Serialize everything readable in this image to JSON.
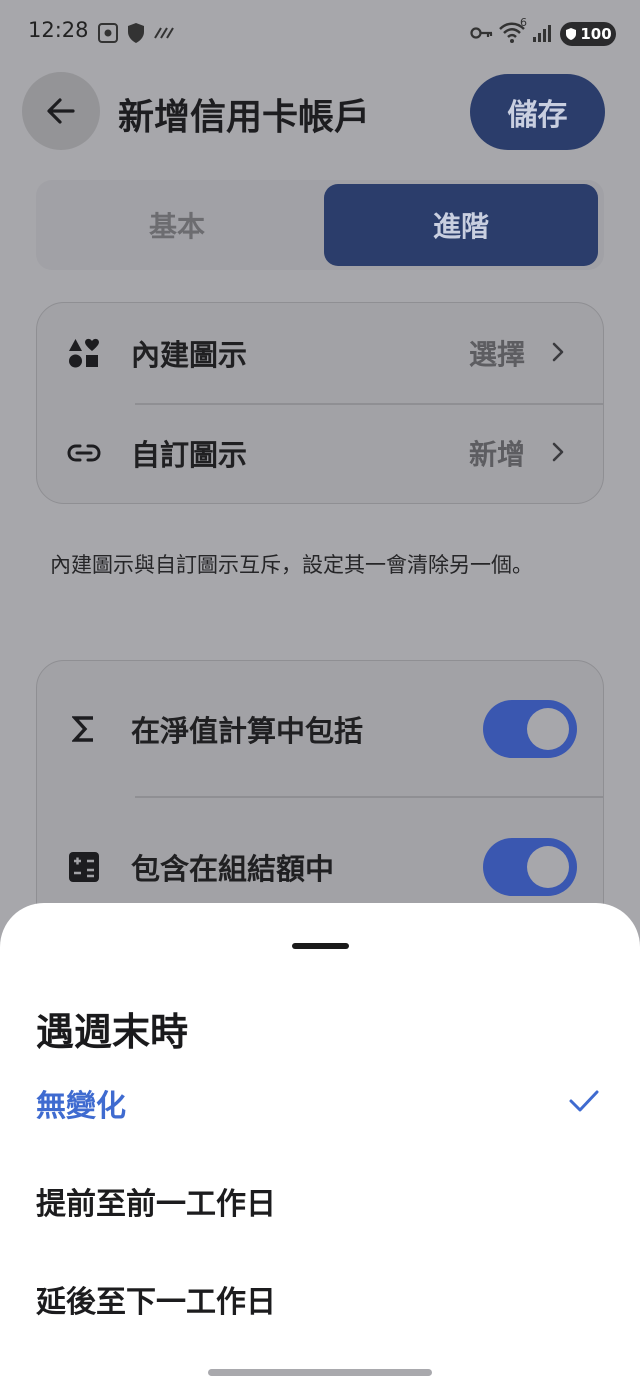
{
  "status_bar": {
    "time": "12:28",
    "battery": "100",
    "wifi_badge": "6"
  },
  "header": {
    "title": "新增信用卡帳戶",
    "save_label": "儲存"
  },
  "tabs": [
    {
      "label": "基本",
      "active": false
    },
    {
      "label": "進階",
      "active": true
    }
  ],
  "icon_card": {
    "rows": [
      {
        "icon": "shapes-icon",
        "label": "內建圖示",
        "value": "選擇"
      },
      {
        "icon": "link-icon",
        "label": "自訂圖示",
        "value": "新增"
      }
    ]
  },
  "icon_note": "內建圖示與自訂圖示互斥，設定其一會清除另一個。",
  "toggle_card": {
    "rows": [
      {
        "icon": "sigma-icon",
        "label": "在淨值計算中包括",
        "on": true
      },
      {
        "icon": "calculator-icon",
        "label": "包含在組結額中",
        "on": true
      }
    ]
  },
  "sheet": {
    "title": "遇週末時",
    "options": [
      {
        "label": "無變化",
        "selected": true
      },
      {
        "label": "提前至前一工作日",
        "selected": false
      },
      {
        "label": "延後至下一工作日",
        "selected": false
      }
    ]
  },
  "colors": {
    "accent": "#3f6bd0",
    "primary_dark": "#2b3d6b",
    "toggle_on": "#3a57b0",
    "scrim": "#a7a7ab"
  }
}
